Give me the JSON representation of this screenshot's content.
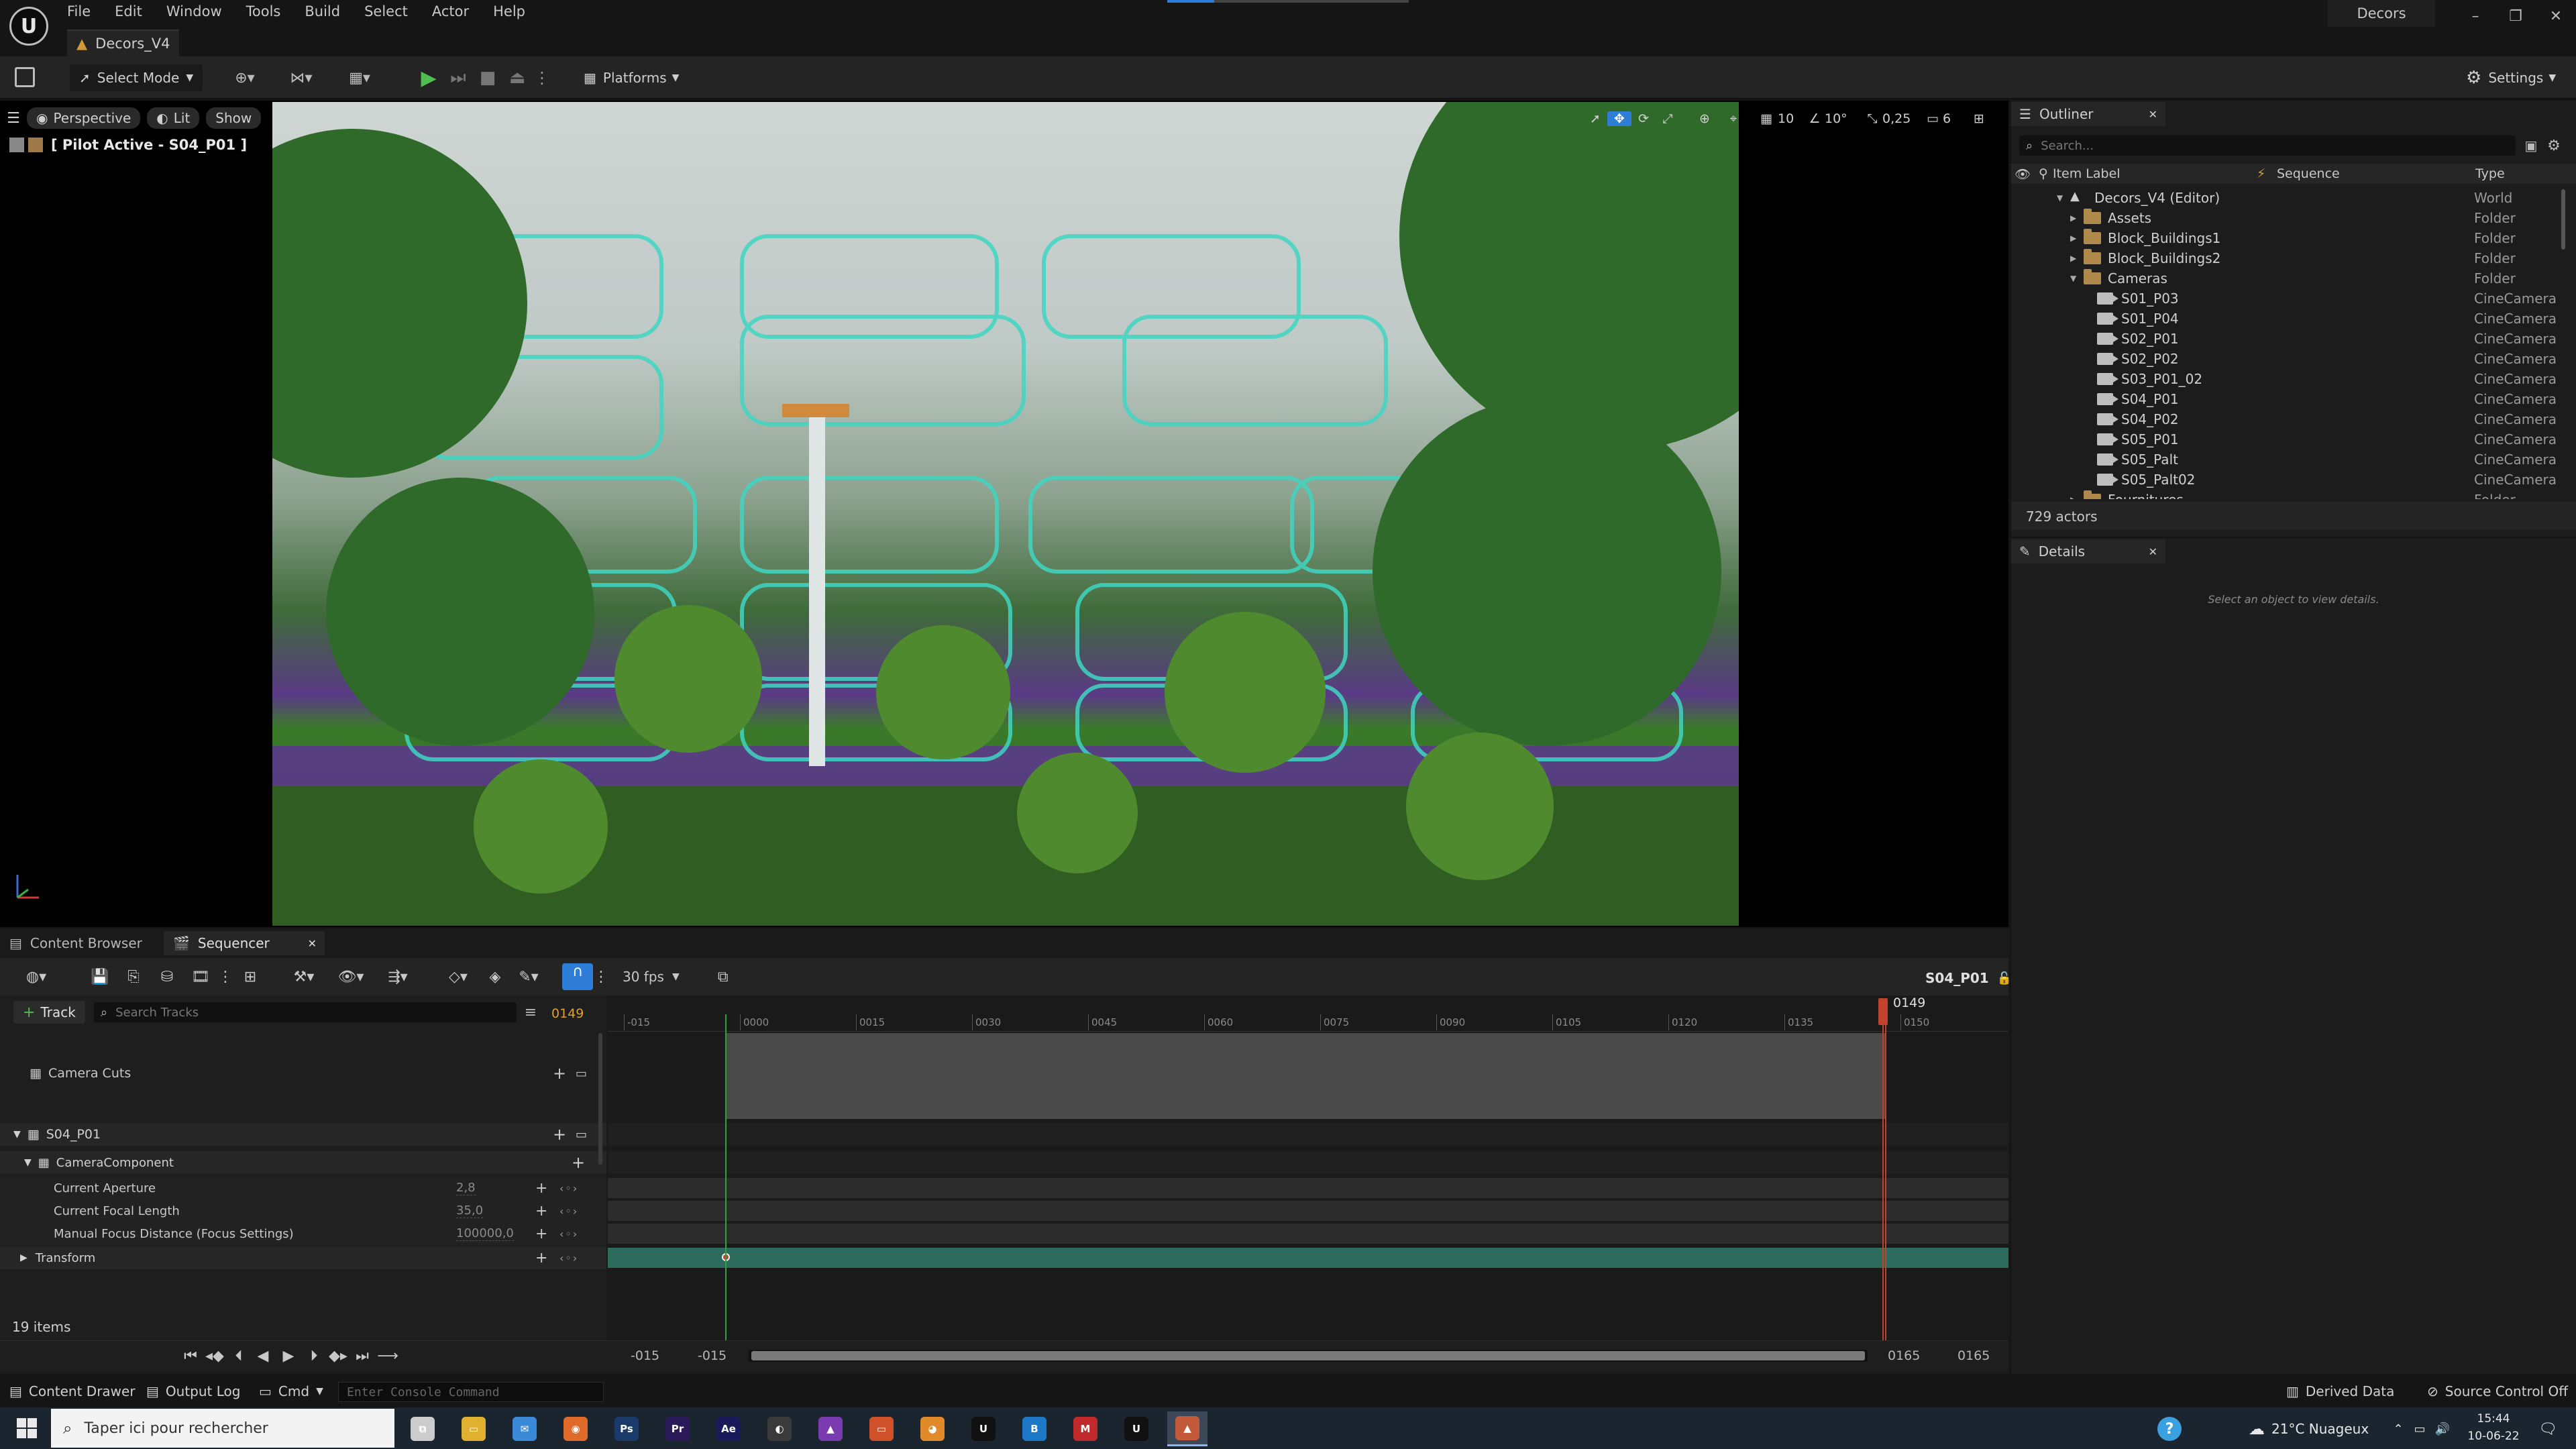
{
  "menu": {
    "items": [
      "File",
      "Edit",
      "Window",
      "Tools",
      "Build",
      "Select",
      "Actor",
      "Help"
    ],
    "project_label": "Decors",
    "tab_title": "Decors_V4"
  },
  "toolbar": {
    "select_mode": "Select Mode",
    "platforms": "Platforms",
    "settings": "Settings"
  },
  "viewport": {
    "perspective": "Perspective",
    "lit": "Lit",
    "show": "Show",
    "pilot_label": "[ Pilot Active - S04_P01 ]",
    "grid_snap": "10",
    "rotation_snap": "10°",
    "scale_snap": "0,25",
    "camera_speed": "6"
  },
  "outliner": {
    "tab": "Outliner",
    "search_placeholder": "Search...",
    "col_label": "Item Label",
    "col_sequence": "Sequence",
    "col_type": "Type",
    "rows": [
      {
        "label": "Decors_V4 (Editor)",
        "type": "World",
        "depth": 0,
        "icon": "world-icon",
        "expanded": true
      },
      {
        "label": "Assets",
        "type": "Folder",
        "depth": 1,
        "icon": "folder-icon",
        "expanded": false
      },
      {
        "label": "Block_Buildings1",
        "type": "Folder",
        "depth": 1,
        "icon": "folder-icon",
        "expanded": false
      },
      {
        "label": "Block_Buildings2",
        "type": "Folder",
        "depth": 1,
        "icon": "folder-icon",
        "expanded": false
      },
      {
        "label": "Cameras",
        "type": "Folder",
        "depth": 1,
        "icon": "folder-icon",
        "expanded": true
      },
      {
        "label": "S01_P03",
        "type": "CineCamera",
        "depth": 2,
        "icon": "cinecamera-icon"
      },
      {
        "label": "S01_P04",
        "type": "CineCamera",
        "depth": 2,
        "icon": "cinecamera-icon"
      },
      {
        "label": "S02_P01",
        "type": "CineCamera",
        "depth": 2,
        "icon": "cinecamera-icon"
      },
      {
        "label": "S02_P02",
        "type": "CineCamera",
        "depth": 2,
        "icon": "cinecamera-icon"
      },
      {
        "label": "S03_P01_02",
        "type": "CineCamera",
        "depth": 2,
        "icon": "cinecamera-icon"
      },
      {
        "label": "S04_P01",
        "type": "CineCamera",
        "depth": 2,
        "icon": "cinecamera-icon"
      },
      {
        "label": "S04_P02",
        "type": "CineCamera",
        "depth": 2,
        "icon": "cinecamera-icon"
      },
      {
        "label": "S05_P01",
        "type": "CineCamera",
        "depth": 2,
        "icon": "cinecamera-icon"
      },
      {
        "label": "S05_Palt",
        "type": "CineCamera",
        "depth": 2,
        "icon": "cinecamera-icon"
      },
      {
        "label": "S05_Palt02",
        "type": "CineCamera",
        "depth": 2,
        "icon": "cinecamera-icon"
      },
      {
        "label": "Fournitures",
        "type": "Folder",
        "depth": 1,
        "icon": "folder-icon",
        "expanded": false
      }
    ],
    "actor_count": "729 actors"
  },
  "details": {
    "tab": "Details",
    "empty_text": "Select an object to view details."
  },
  "bottom_tabs": {
    "content_browser": "Content Browser",
    "sequencer": "Sequencer"
  },
  "sequencer": {
    "fps": "30 fps",
    "sequence_name": "S04_P01",
    "add_track": "Track",
    "search_placeholder": "Search Tracks",
    "current_frame": "0149",
    "playhead_label": "0149",
    "tracks": {
      "camera_cuts": "Camera Cuts",
      "binding": "S04_P01",
      "component": "CameraComponent",
      "properties": [
        {
          "label": "Current Aperture",
          "value": "2,8"
        },
        {
          "label": "Current Focal Length",
          "value": "35,0"
        },
        {
          "label": "Manual Focus Distance (Focus Settings)",
          "value": "100000,0"
        }
      ],
      "transform": "Transform"
    },
    "items_count": "19 items",
    "ruler_ticks": [
      "-015",
      "0000",
      "0015",
      "0030",
      "0045",
      "0060",
      "0075",
      "0090",
      "0105",
      "0120",
      "0135",
      "0150"
    ],
    "range_start_outer": "-015",
    "range_start_inner": "-015",
    "range_end_inner": "0165",
    "range_end_outer": "0165"
  },
  "status_bar": {
    "content_drawer": "Content Drawer",
    "output_log": "Output Log",
    "cmd": "Cmd",
    "console_placeholder": "Enter Console Command",
    "derived_data": "Derived Data",
    "source_control": "Source Control Off"
  },
  "taskbar": {
    "search_placeholder": "Taper ici pour rechercher",
    "weather": "21°C  Nuageux",
    "time": "15:44",
    "date": "10-06-22",
    "apps": [
      "task-view-icon",
      "file-explorer-icon",
      "mail-icon",
      "firefox-icon",
      "photoshop-icon",
      "premiere-icon",
      "after-effects-icon",
      "davinci-icon",
      "affinity-icon",
      "office-icon",
      "blender-icon",
      "unreal-icon",
      "bridge-icon",
      "mega-icon",
      "unreal-icon-2",
      "unreal-active-icon"
    ]
  },
  "colors": {
    "accent": "#2e7dd6",
    "panel": "#1c1c1c",
    "playhead": "#c2432b",
    "start_marker": "#2ea043",
    "transform_row": "#2d6b5c"
  }
}
